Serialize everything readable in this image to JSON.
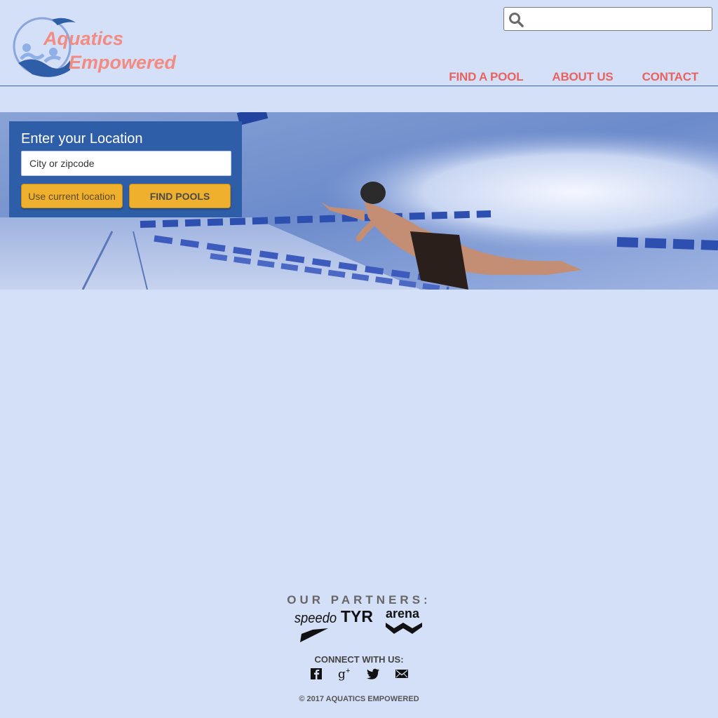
{
  "header": {
    "logo_line1": "Aquatics",
    "logo_line2": "Empowered",
    "search": {
      "placeholder": "",
      "value": ""
    },
    "nav": [
      {
        "label": "FIND A POOL"
      },
      {
        "label": "ABOUT US"
      },
      {
        "label": "CONTACT"
      }
    ]
  },
  "location_panel": {
    "title": "Enter your Location",
    "input_placeholder": "City or zipcode",
    "use_current_label": "Use current location",
    "find_label": "FIND POOLS"
  },
  "footer": {
    "partners_title": "OUR PARTNERS:",
    "partners": [
      "speedo",
      "TYR",
      "arena"
    ],
    "connect_title": "CONNECT WITH US:",
    "social": [
      "facebook-icon",
      "google-plus-icon",
      "twitter-icon",
      "email-icon"
    ],
    "copyright": "© 2017 AQUATICS EMPOWERED"
  },
  "colors": {
    "background": "#d4e0f7",
    "accent": "#e8635f",
    "panel": "#2f5ea8",
    "button": "#efb02e"
  }
}
